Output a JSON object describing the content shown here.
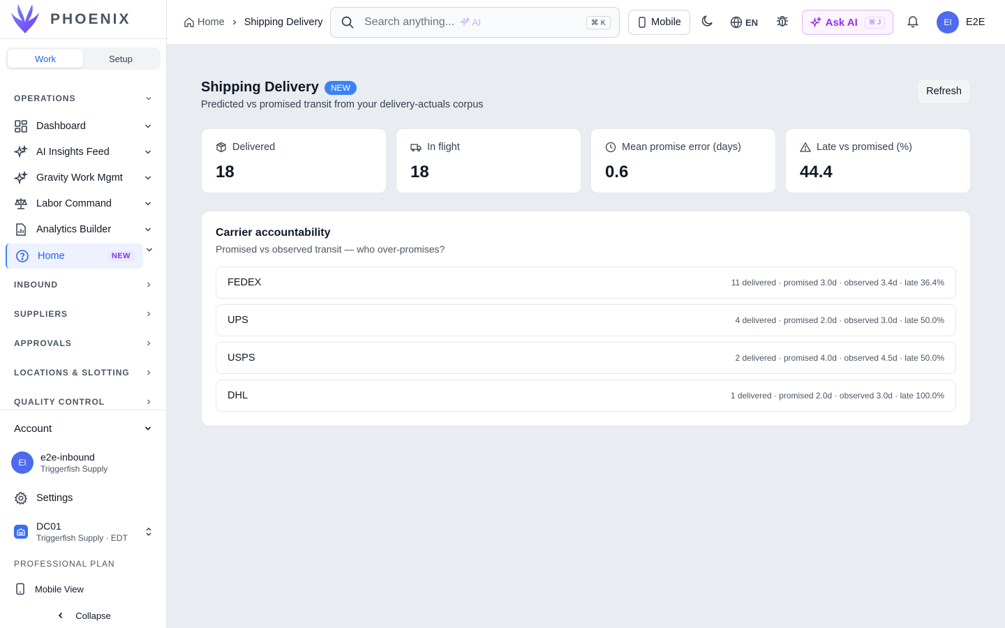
{
  "brand": {
    "name": "PHOENIX"
  },
  "workspace_tabs": [
    "Work",
    "Setup"
  ],
  "sidebar": {
    "sections": {
      "operations": "OPERATIONS",
      "inbound": "INBOUND",
      "suppliers": "SUPPLIERS",
      "approvals": "APPROVALS",
      "locations": "LOCATIONS & SLOTTING",
      "quality": "QUALITY CONTROL"
    },
    "items": [
      {
        "label": "Dashboard"
      },
      {
        "label": "AI Insights Feed"
      },
      {
        "label": "Gravity Work Mgmt"
      },
      {
        "label": "Labor Command"
      },
      {
        "label": "Analytics Builder"
      },
      {
        "label": "Home",
        "badge": "NEW"
      }
    ],
    "account": {
      "title": "Account",
      "user_initials": "EI",
      "user_name": "e2e-inbound",
      "user_org": "Triggerfish Supply",
      "settings_label": "Settings",
      "dc_name": "DC01",
      "dc_sub": "Triggerfish Supply · EDT",
      "plan": "PROFESSIONAL PLAN",
      "mobile_view": "Mobile View",
      "collapse": "Collapse"
    }
  },
  "topbar": {
    "breadcrumb_home": "Home",
    "breadcrumb_current": "Shipping Delivery",
    "search_placeholder": "Search anything...",
    "search_ai": "AI",
    "search_shortcut": "⌘ K",
    "mobile_label": "Mobile",
    "language": "EN",
    "ask_ai_label": "Ask AI",
    "ask_ai_shortcut": "⌘ J",
    "user_initials": "EI",
    "user_label": "E2E"
  },
  "page": {
    "title": "Shipping Delivery",
    "badge": "NEW",
    "subtitle": "Predicted vs promised transit from your delivery-actuals corpus",
    "refresh_label": "Refresh"
  },
  "stats": [
    {
      "label": "Delivered",
      "value": "18",
      "icon": "package-icon"
    },
    {
      "label": "In flight",
      "value": "18",
      "icon": "truck-icon"
    },
    {
      "label": "Mean promise error (days)",
      "value": "0.6",
      "icon": "clock-icon"
    },
    {
      "label": "Late vs promised (%)",
      "value": "44.4",
      "icon": "warning-icon"
    }
  ],
  "carrier_card": {
    "title": "Carrier accountability",
    "subtitle": "Promised vs observed transit — who over-promises?",
    "rows": [
      {
        "carrier": "FEDEX",
        "stats": "11 delivered · promised 3.0d · observed 3.4d · late 36.4%"
      },
      {
        "carrier": "UPS",
        "stats": "4 delivered · promised 2.0d · observed 3.0d · late 50.0%"
      },
      {
        "carrier": "USPS",
        "stats": "2 delivered · promised 4.0d · observed 4.5d · late 50.0%"
      },
      {
        "carrier": "DHL",
        "stats": "1 delivered · promised 2.0d · observed 3.0d · late 100.0%"
      }
    ]
  },
  "colors": {
    "accent": "#3b82f6",
    "ai": "#9333ea",
    "avatar": "#4f6bed"
  }
}
